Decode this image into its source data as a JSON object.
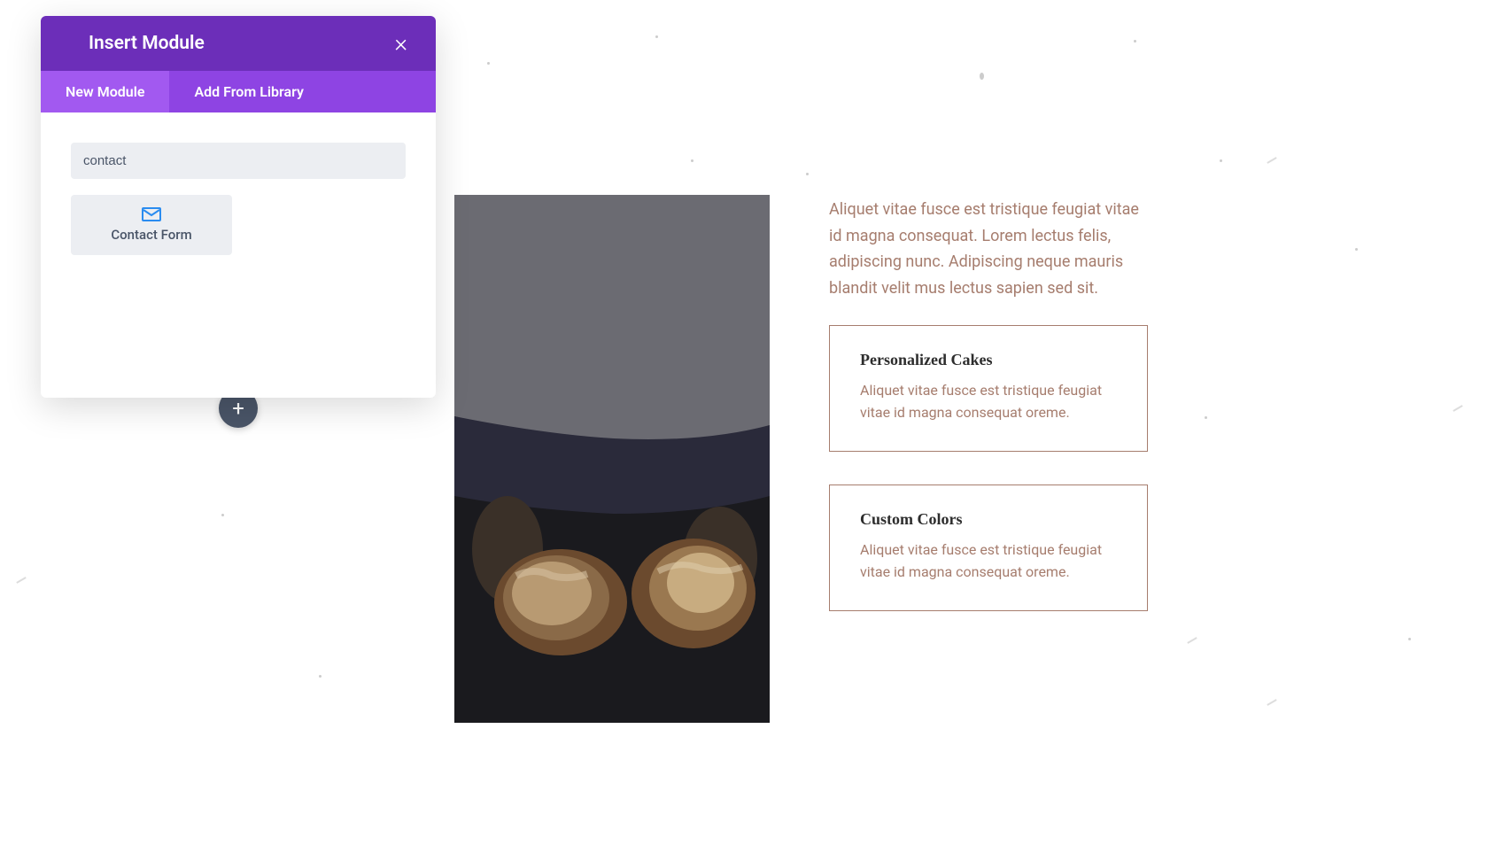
{
  "modal": {
    "title": "Insert Module",
    "tabs": {
      "new": "New Module",
      "library": "Add From Library"
    },
    "search_value": "contact",
    "modules": [
      {
        "label": "Contact Form",
        "icon": "envelope"
      }
    ]
  },
  "content": {
    "intro_text": "Aliquet vitae fusce est tristique feugiat vitae id magna consequat. Lorem lectus felis, adipiscing nunc. Adipiscing neque mauris blandit velit mus lectus sapien sed sit.",
    "cards": [
      {
        "title": "Personalized Cakes",
        "text": "Aliquet vitae fusce est tristique feugiat vitae id magna consequat oreme."
      },
      {
        "title": "Custom Colors",
        "text": "Aliquet vitae fusce est tristique feugiat vitae id magna consequat oreme."
      }
    ]
  }
}
